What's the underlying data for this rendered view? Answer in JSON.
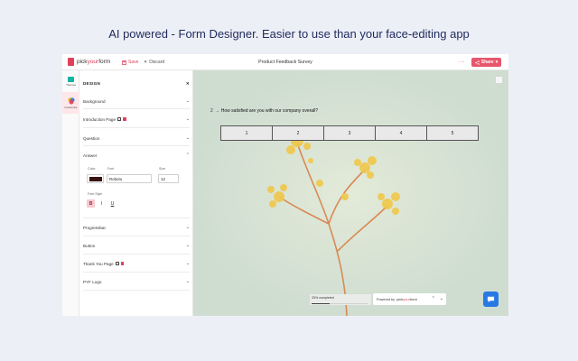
{
  "headline": "AI powered - Form Designer.  Easier to use than your face-editing app",
  "topbar": {
    "logo_text_a": "pick",
    "logo_text_b": "your",
    "logo_text_c": "form",
    "save_label": "Save",
    "discard_label": "Discard",
    "form_title": "Product Feedback Survey",
    "share_label": "Share"
  },
  "rail": {
    "items": [
      {
        "label": "Themes",
        "icon": "palette-icon",
        "color": "#14b3a4"
      },
      {
        "label": "Customize",
        "icon": "paint-icon",
        "color": "#e0405a"
      }
    ]
  },
  "panel": {
    "title": "DESIGN",
    "sections": {
      "background": "Background",
      "intro": "Introduction Page",
      "question": "Question",
      "answer": "Answer",
      "progressbar": "Progressbar",
      "button": "Button",
      "thankyou": "Thank You Page",
      "logo": "PYF Logo"
    },
    "answer": {
      "color_label": "Color",
      "color_value": "#3a1414",
      "font_label": "Font",
      "font_value": "Roboto",
      "size_label": "Size",
      "size_value": "12",
      "style_label": "Font Style",
      "bold": "B",
      "italic": "I",
      "underline": "U"
    }
  },
  "canvas": {
    "question_number": "2",
    "question_text": "How satisfied are you with our company overall?",
    "scale": [
      "1",
      "2",
      "3",
      "4",
      "5"
    ],
    "progress_text": "33% completed",
    "progress_fraction": 0.33,
    "powered_by": "Powered by",
    "brand_a": "pick",
    "brand_b": "your",
    "brand_c": "form"
  },
  "colors": {
    "accent": "#e0405a",
    "canvas_bg": "#cfddd1",
    "chat": "#2979e4"
  }
}
